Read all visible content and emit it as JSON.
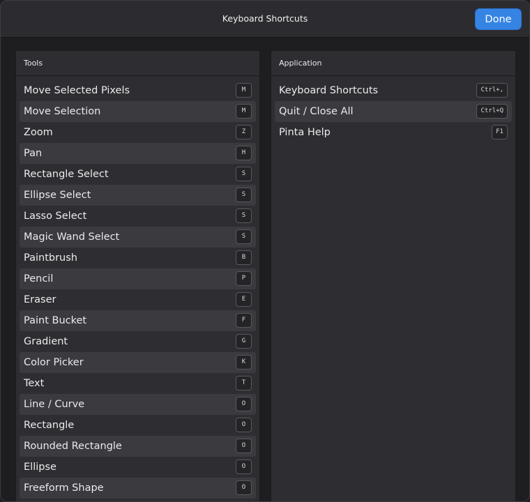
{
  "dialog": {
    "title": "Keyboard Shortcuts",
    "done_label": "Done"
  },
  "tools": {
    "heading": "Tools",
    "items": [
      {
        "label": "Move Selected Pixels",
        "key": "M"
      },
      {
        "label": "Move Selection",
        "key": "M"
      },
      {
        "label": "Zoom",
        "key": "Z"
      },
      {
        "label": "Pan",
        "key": "H"
      },
      {
        "label": "Rectangle Select",
        "key": "S"
      },
      {
        "label": "Ellipse Select",
        "key": "S"
      },
      {
        "label": "Lasso Select",
        "key": "S"
      },
      {
        "label": "Magic Wand Select",
        "key": "S"
      },
      {
        "label": "Paintbrush",
        "key": "B"
      },
      {
        "label": "Pencil",
        "key": "P"
      },
      {
        "label": "Eraser",
        "key": "E"
      },
      {
        "label": "Paint Bucket",
        "key": "F"
      },
      {
        "label": "Gradient",
        "key": "G"
      },
      {
        "label": "Color Picker",
        "key": "K"
      },
      {
        "label": "Text",
        "key": "T"
      },
      {
        "label": "Line / Curve",
        "key": "O"
      },
      {
        "label": "Rectangle",
        "key": "O"
      },
      {
        "label": "Rounded Rectangle",
        "key": "O"
      },
      {
        "label": "Ellipse",
        "key": "O"
      },
      {
        "label": "Freeform Shape",
        "key": "O"
      }
    ]
  },
  "application": {
    "heading": "Application",
    "items": [
      {
        "label": "Keyboard Shortcuts",
        "key": "Ctrl+,"
      },
      {
        "label": "Quit / Close All",
        "key": "Ctrl+Q"
      },
      {
        "label": "Pinta Help",
        "key": "F1"
      }
    ]
  },
  "colors": {
    "accent": "#3584e4",
    "row_alt": "#3a3a3f",
    "panel": "#2e2e32",
    "header": "#2c2c30"
  }
}
